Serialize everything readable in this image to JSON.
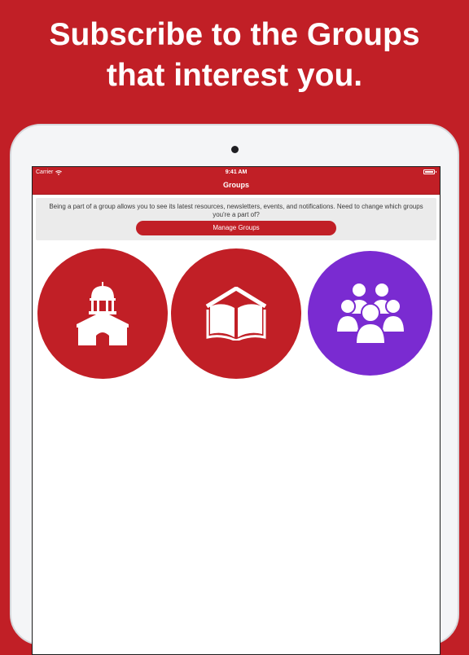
{
  "promo": {
    "headline_line1": "Subscribe to the Groups",
    "headline_line2": "that interest you."
  },
  "status_bar": {
    "carrier": "Carrier",
    "time": "9:41 AM",
    "wifi_icon": "wifi-icon",
    "battery_icon": "battery-icon"
  },
  "nav": {
    "title": "Groups"
  },
  "info": {
    "text": "Being a part of a group allows you to see its latest resources, newsletters, events, and notifications. Need to change which groups you're a part of?",
    "button_label": "Manage Groups"
  },
  "groups": [
    {
      "icon": "capitol-building-icon",
      "color": "#c11f26"
    },
    {
      "icon": "open-book-icon",
      "color": "#c11f26"
    },
    {
      "icon": "people-group-icon",
      "color": "#7a2bd1"
    }
  ],
  "colors": {
    "brand_red": "#c11f26",
    "accent_purple": "#7a2bd1",
    "device_frame": "#f4f5f7"
  }
}
